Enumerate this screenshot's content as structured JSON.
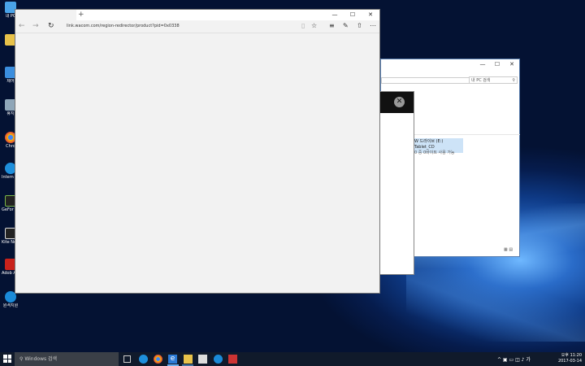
{
  "desktop": {
    "icons": [
      {
        "label": "내 PC",
        "color": "#4aa3e8"
      },
      {
        "label": "",
        "color": "#e8c24a"
      },
      {
        "label": "제어",
        "color": "#3b8ede"
      },
      {
        "label": "휴지",
        "color": "#8fa6b8"
      },
      {
        "label": "Chro",
        "color": "#e04a3a"
      },
      {
        "label": "Intern explo",
        "color": "#1e8fdc"
      },
      {
        "label": "GeFor Experie",
        "color": "#222222"
      },
      {
        "label": "Kite Netwo",
        "color": "#222222"
      },
      {
        "label": "Adob Acrobat",
        "color": "#c9221b"
      },
      {
        "label": "원격지원",
        "color": "#1a8ad8"
      }
    ]
  },
  "browser": {
    "new_tab_symbol": "+",
    "url": "link.wacom.com/region-redirector/product?pid=0x0338",
    "minimize": "—",
    "maximize": "☐",
    "close": "✕"
  },
  "explorer": {
    "search_placeholder": "내 PC 검색",
    "item_title": "W 드라이브 (E:) Tablet_CD",
    "item_subtitle": "0 중 0바이트 사용 가능"
  },
  "dialog": {
    "close_symbol": "✕"
  },
  "taskbar": {
    "search_placeholder": "Windows 검색",
    "time": "오후 11:20",
    "date": "2017-03-14"
  },
  "colors": {
    "accent": "#6ab0f3",
    "taskbar": "#101a2b"
  }
}
